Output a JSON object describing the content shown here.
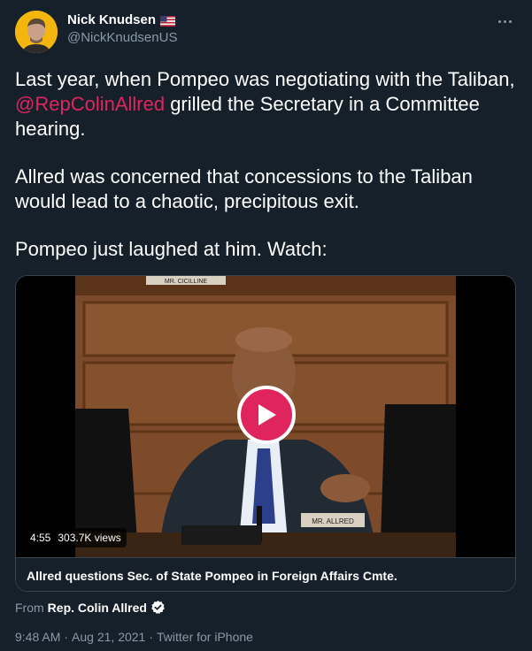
{
  "author": {
    "name": "Nick Knudsen",
    "handle": "@NickKnudsenUS",
    "flag_icon": "us-flag-icon"
  },
  "tweet": {
    "paragraph1_before": "Last year, when Pompeo was negotiating with the Taliban, ",
    "mention": "@RepColinAllred",
    "paragraph1_after": " grilled the Secretary in a Committee hearing.",
    "paragraph2": "Allred was concerned that concessions to the Taliban would lead to a chaotic, precipitous exit.",
    "paragraph3": "Pompeo just laughed at him. Watch:"
  },
  "media": {
    "duration": "4:55",
    "views": "303.7K views",
    "title": "Allred questions Sec. of State Pompeo in Foreign Affairs Cmte.",
    "nameplate_top": "MR. CICILLINE",
    "nameplate_bottom": "MR. ALLRED"
  },
  "attribution": {
    "from_label": "From",
    "source_name": "Rep. Colin Allred",
    "verified_icon": "verified-badge-icon"
  },
  "meta": {
    "time": "9:48 AM",
    "separator": "·",
    "date": "Aug 21, 2021",
    "client": "Twitter for iPhone"
  },
  "colors": {
    "background": "#15202b",
    "secondary_text": "#8899a6",
    "mention": "#e0245e",
    "play_button": "#e0245e",
    "border": "#38444d"
  }
}
